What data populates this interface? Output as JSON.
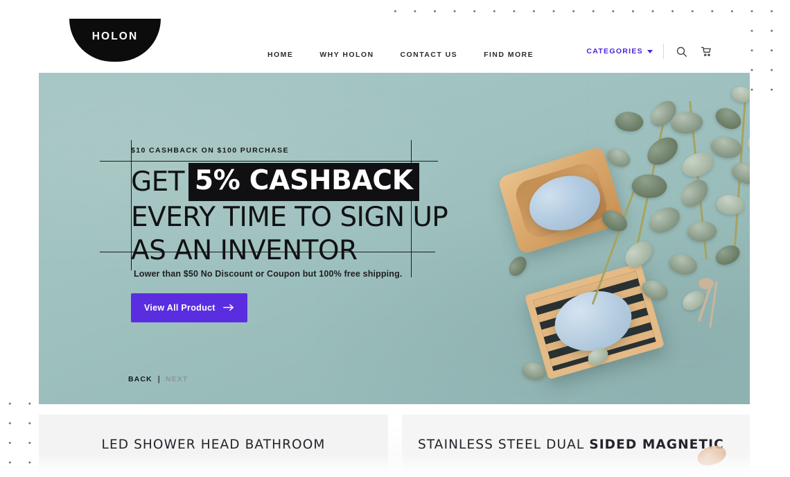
{
  "brand": {
    "logo_text": "HOLON"
  },
  "nav": {
    "items": [
      {
        "label": "HOME"
      },
      {
        "label": "WHY HOLON"
      },
      {
        "label": "CONTACT US"
      },
      {
        "label": "FIND MORE"
      }
    ],
    "categories_label": "CATEGORIES",
    "icons": [
      {
        "name": "search-icon"
      },
      {
        "name": "cart-icon"
      }
    ]
  },
  "hero": {
    "eyebrow": "$10 CASHBACK ON $100 PURCHASE",
    "headline_line1_plain": "GET",
    "headline_line1_mark": "5% CASHBACK",
    "headline_line2": "EVERY TIME TO SIGN UP",
    "headline_line3": "AS AN INVENTOR",
    "subtext": "Lower than $50 No Discount or Coupon but 100% free shipping.",
    "cta_label": "View All Product",
    "cta_arrow": "→",
    "slider": {
      "back_label": "BACK",
      "separator": "|",
      "next_label": "NEXT"
    }
  },
  "products": [
    {
      "title": "LED SHOWER HEAD BATHROOM",
      "title_bold": ""
    },
    {
      "title": "STAINLESS STEEL DUAL ",
      "title_bold": "SIDED MAGNETIC"
    }
  ],
  "colors": {
    "accent_purple": "#5a2ee0",
    "categories_purple": "#4a24d6",
    "hero_teal": "#9ec1bf",
    "highlight_black": "#101013",
    "card_gray": "#f3f3f4",
    "dot_gray": "#6e7176"
  }
}
